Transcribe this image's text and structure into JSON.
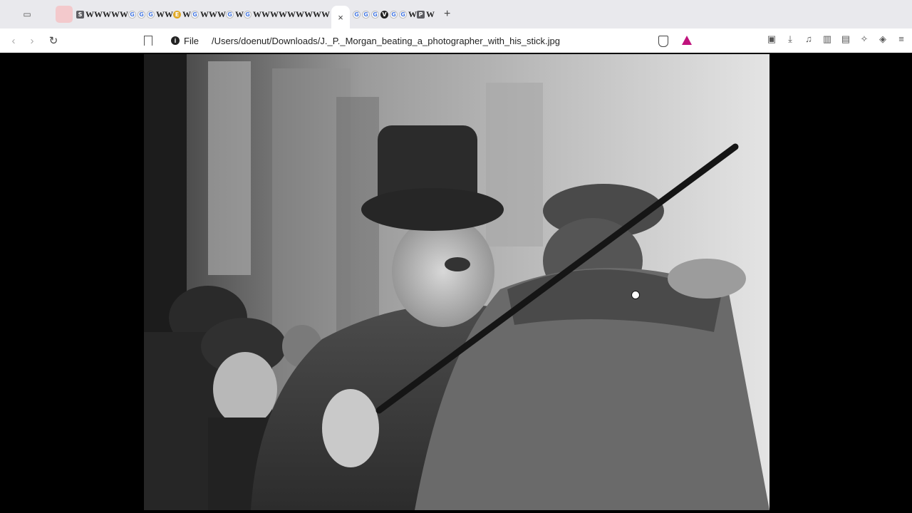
{
  "window": {
    "active_tab_close": "×",
    "new_tab": "+"
  },
  "tabs": {
    "favicons": [
      "S",
      "W",
      "W",
      "W",
      "W",
      "W",
      "G",
      "G",
      "G",
      "W",
      "W",
      "E",
      "W",
      "G",
      "W",
      "W",
      "W",
      "G",
      "W",
      "G",
      "W",
      "W",
      "W",
      "W",
      "W",
      "W",
      "W",
      "W",
      "W",
      "G",
      "G",
      "G",
      "V",
      "G",
      "G",
      "W",
      "P",
      "W"
    ]
  },
  "toolbar": {
    "scheme_label": "File",
    "url": "/Users/doenut/Downloads/J._P._Morgan_beating_a_photographer_with_his_stick.jpg"
  },
  "icons": {
    "back": "back-icon",
    "forward": "forward-icon",
    "reload": "reload-icon",
    "bookmark": "bookmark-icon",
    "info": "info-icon",
    "shields": "brave-shield-icon",
    "rewards": "brave-rewards-icon",
    "reader": "reader-mode-icon",
    "downloads": "download-icon",
    "media": "music-icon",
    "sidebar": "sidebar-icon",
    "wallet": "wallet-icon",
    "leo": "leo-ai-icon",
    "vpn": "vpn-icon",
    "menu": "menu-icon"
  },
  "colors": {
    "tabstrip_bg": "#e9e9ed",
    "toolbar_bg": "#ffffff",
    "viewer_bg": "#000000",
    "rewards_accent": "#c0127c"
  },
  "image": {
    "description_visible": "black-and-white photograph"
  }
}
